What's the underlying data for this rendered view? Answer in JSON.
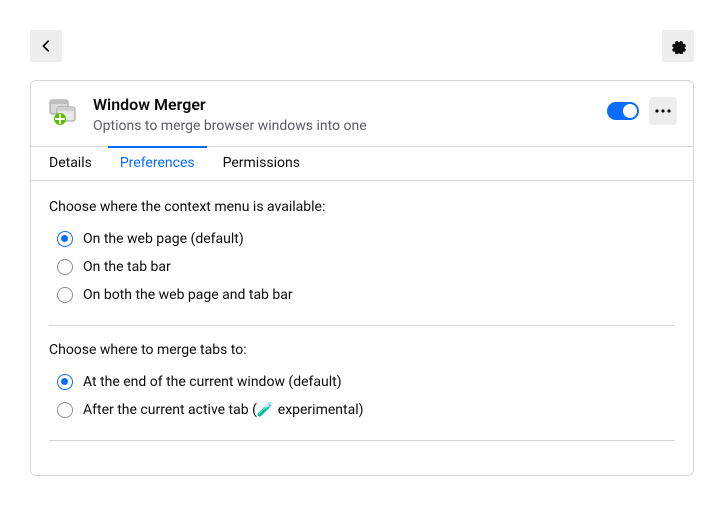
{
  "extension": {
    "title": "Window Merger",
    "subtitle": "Options to merge browser windows into one"
  },
  "tabs": {
    "details": "Details",
    "preferences": "Preferences",
    "permissions": "Permissions"
  },
  "sections": {
    "contextMenu": {
      "label": "Choose where the context menu is available:",
      "options": {
        "webpage": "On the web page (default)",
        "tabbar": "On the tab bar",
        "both": "On both the web page and tab bar"
      }
    },
    "mergeTo": {
      "label": "Choose where to merge tabs to:",
      "options": {
        "end": "At the end of the current window (default)",
        "afterActive_prefix": "After the current active tab (",
        "afterActive_suffix": " experimental)"
      }
    }
  },
  "icons": {
    "experimental_emoji": "🧪"
  }
}
